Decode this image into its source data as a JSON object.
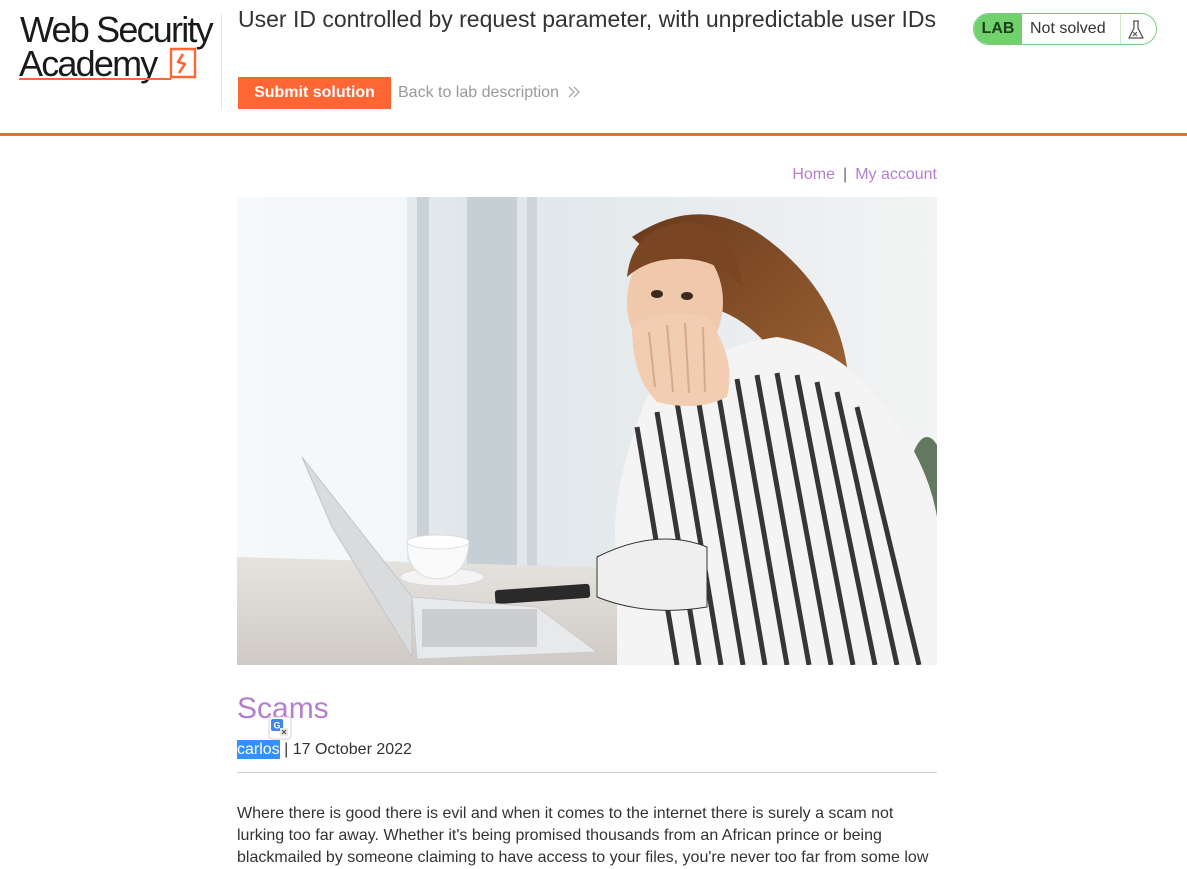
{
  "header": {
    "logo_line1": "Web Security",
    "logo_line2": "Academy",
    "lab_title": "User ID controlled by request parameter, with unpredictable user IDs",
    "submit_label": "Submit solution",
    "back_link_label": "Back to lab description",
    "lab_badge": "LAB",
    "lab_status": "Not solved"
  },
  "nav": {
    "home": "Home",
    "separator": "|",
    "my_account": "My account"
  },
  "post": {
    "title": "Scams",
    "author": "carlos",
    "date_sep": " | ",
    "date": "17 October 2022",
    "body": "Where there is good there is evil and when it comes to the internet there is surely a scam not lurking too far away. Whether it's being promised thousands from an African prince or being blackmailed by someone claiming to have access to your files, you're never too far from some low"
  },
  "colors": {
    "accent": "#ff6633",
    "link": "#b47fcf",
    "lab_green": "#70d16d",
    "selection": "#3390ff"
  },
  "icons": {
    "logo_mark": "academy-logo-mark",
    "back_chevron": "double-chevron-right-icon",
    "flask": "flask-icon",
    "translate": "google-translate-icon"
  }
}
